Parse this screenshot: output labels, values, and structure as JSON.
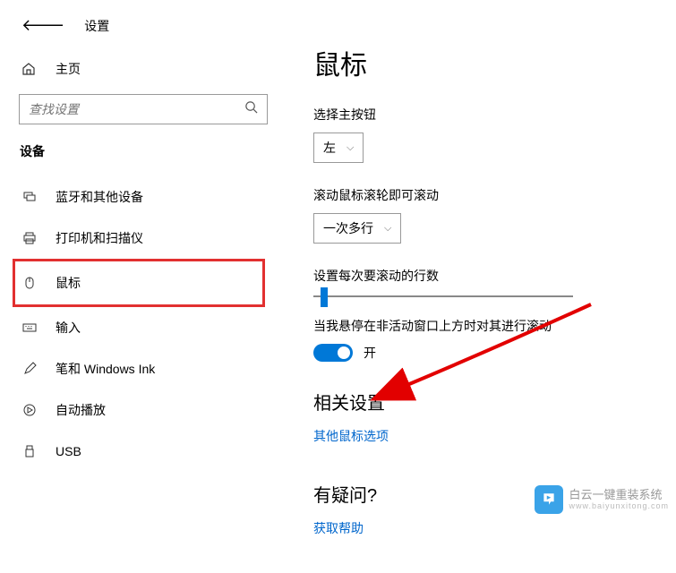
{
  "header": {
    "settings_title": "设置",
    "home_label": "主页"
  },
  "search": {
    "placeholder": "查找设置"
  },
  "section_header": "设备",
  "nav": {
    "items": [
      {
        "label": "蓝牙和其他设备"
      },
      {
        "label": "打印机和扫描仪"
      },
      {
        "label": "鼠标"
      },
      {
        "label": "输入"
      },
      {
        "label": "笔和 Windows Ink"
      },
      {
        "label": "自动播放"
      },
      {
        "label": "USB"
      }
    ]
  },
  "content": {
    "page_title": "鼠标",
    "primary_button_label": "选择主按钮",
    "primary_button_value": "左",
    "scroll_label": "滚动鼠标滚轮即可滚动",
    "scroll_value": "一次多行",
    "lines_label": "设置每次要滚动的行数",
    "hover_label": "当我悬停在非活动窗口上方时对其进行滚动",
    "toggle_state": "开",
    "related_header": "相关设置",
    "related_link": "其他鼠标选项",
    "question_header": "有疑问?",
    "help_link": "获取帮助"
  },
  "watermark": {
    "line1": "白云一键重装系统",
    "line2": "www.baiyunxitong.com"
  }
}
